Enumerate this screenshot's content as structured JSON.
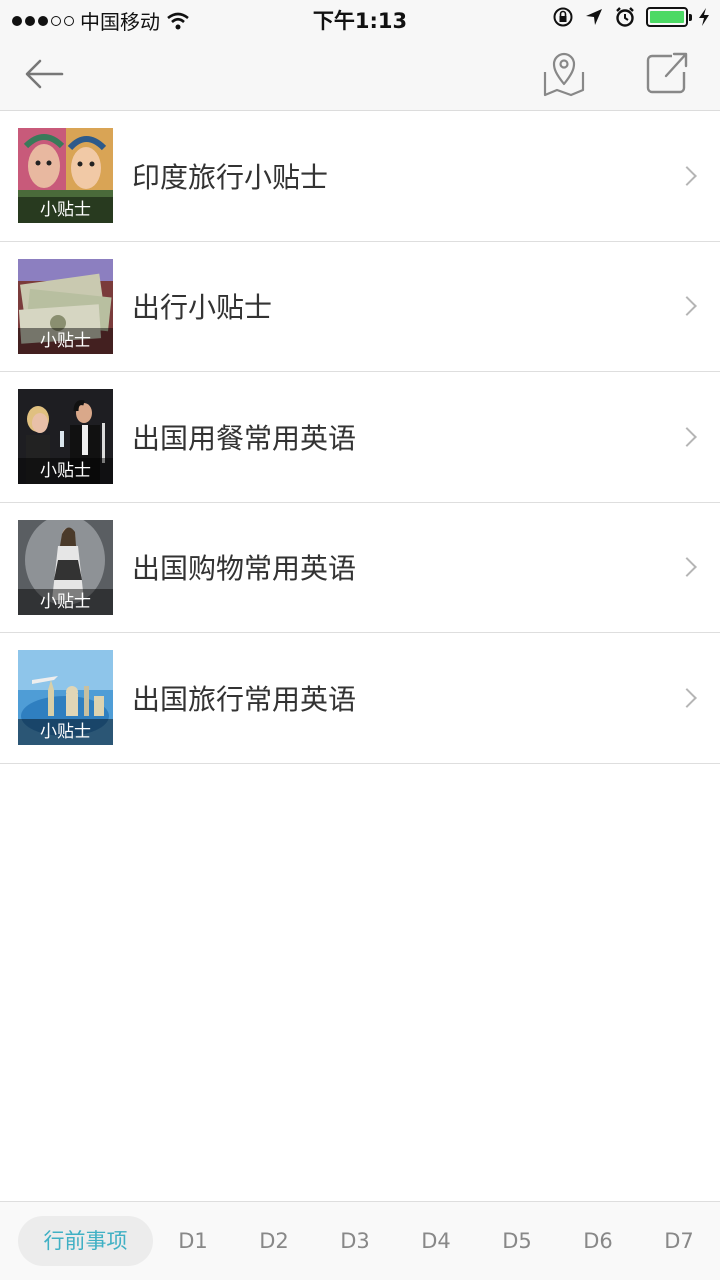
{
  "status_bar": {
    "carrier": "中国移动",
    "time": "下午1:13",
    "battery_color": "#4cd964",
    "icons": [
      "wifi-icon",
      "rotation-lock-icon",
      "location-arrow-icon",
      "alarm-icon",
      "battery-icon",
      "charging-icon"
    ]
  },
  "nav": {
    "icons": [
      "back-arrow-icon",
      "map-pin-icon",
      "share-icon"
    ]
  },
  "items": [
    {
      "title": "印度旅行小贴士",
      "badge": "小贴士"
    },
    {
      "title": "出行小贴士",
      "badge": "小贴士"
    },
    {
      "title": "出国用餐常用英语",
      "badge": "小贴士"
    },
    {
      "title": "出国购物常用英语",
      "badge": "小贴士"
    },
    {
      "title": "出国旅行常用英语",
      "badge": "小贴士"
    }
  ],
  "tabs": [
    {
      "label": "行前事项",
      "active": true
    },
    {
      "label": "D1"
    },
    {
      "label": "D2"
    },
    {
      "label": "D3"
    },
    {
      "label": "D4"
    },
    {
      "label": "D5"
    },
    {
      "label": "D6"
    },
    {
      "label": "D7"
    }
  ],
  "colors": {
    "accent": "#3fb0c4",
    "text": "#333333",
    "divider": "#dedede"
  }
}
